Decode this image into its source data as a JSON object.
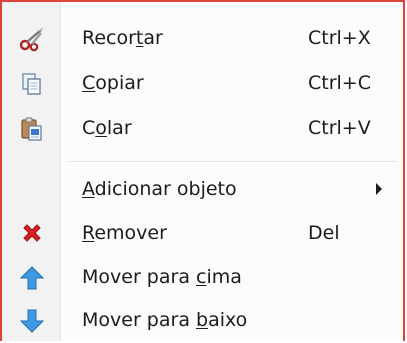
{
  "menu": {
    "items": [
      {
        "icon": "scissors-icon",
        "pre": "Recor",
        "u": "t",
        "post": "ar",
        "shortcut": "Ctrl+X"
      },
      {
        "icon": "copy-icon",
        "pre": "",
        "u": "C",
        "post": "opiar",
        "shortcut": "Ctrl+C"
      },
      {
        "icon": "paste-icon",
        "pre": "C",
        "u": "o",
        "post": "lar",
        "shortcut": "Ctrl+V"
      },
      {
        "icon": "",
        "pre": "",
        "u": "A",
        "post": "dicionar objeto",
        "shortcut": ""
      },
      {
        "icon": "delete-icon",
        "pre": "",
        "u": "R",
        "post": "emover",
        "shortcut": "Del"
      },
      {
        "icon": "arrow-up-icon",
        "pre": "Mover para ",
        "u": "c",
        "post": "ima",
        "shortcut": ""
      },
      {
        "icon": "arrow-down-icon",
        "pre": "Mover para ",
        "u": "b",
        "post": "aixo",
        "shortcut": ""
      }
    ]
  },
  "colors": {
    "border": "#e0433a",
    "delete_red": "#d81f26",
    "arrow_blue": "#2f8fe0"
  }
}
